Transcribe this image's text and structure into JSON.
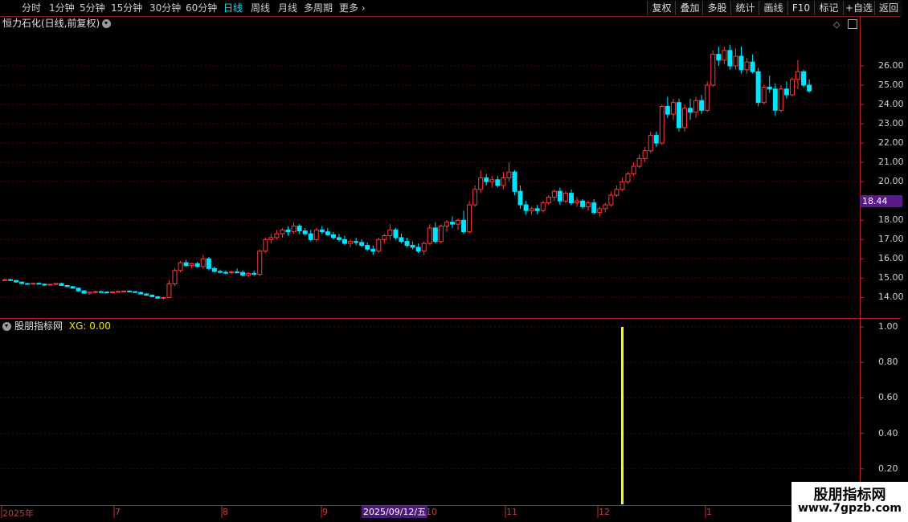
{
  "toolbar": {
    "periods": [
      "分时",
      "1分钟",
      "5分钟",
      "15分钟",
      "30分钟",
      "60分钟",
      "日线",
      "周线",
      "月线",
      "多周期",
      "更多"
    ],
    "active_period": "日线",
    "buttons": [
      "复权",
      "叠加",
      "多股",
      "统计",
      "画线",
      "F10",
      "标记",
      "+自选",
      "返回"
    ]
  },
  "main_chart": {
    "title": "恒力石化(日线,前复权)",
    "current_price": "18.44",
    "y_ticks": [
      "26.00",
      "25.00",
      "24.00",
      "23.00",
      "22.00",
      "21.00",
      "20.00",
      "18.00",
      "17.00",
      "16.00",
      "15.00",
      "14.00"
    ]
  },
  "indicator": {
    "name": "股朋指标网",
    "value_label": "XG: 0.00",
    "y_ticks": [
      "1.00",
      "0.80",
      "0.60",
      "0.40",
      "0.20"
    ]
  },
  "x_axis": {
    "labels": [
      "2025年",
      "7",
      "8",
      "9",
      "10",
      "11",
      "12",
      "1"
    ],
    "cursor_date": "2025/09/12/五"
  },
  "watermark": {
    "title": "股朋指标网",
    "url": "www.7gpzb.com"
  },
  "colors": {
    "up": "#ff3b3b",
    "down": "#00e5ff",
    "grid": "#5a0000",
    "signal": "#ffff00"
  },
  "chart_data": {
    "type": "candlestick",
    "title": "恒力石化(日线,前复权)",
    "ylim": [
      13.6,
      27.0
    ],
    "note_last_price": 18.44,
    "candles": [
      [
        14.9,
        14.95,
        14.85,
        14.92
      ],
      [
        14.92,
        14.98,
        14.86,
        14.88
      ],
      [
        14.88,
        14.9,
        14.78,
        14.8
      ],
      [
        14.8,
        14.82,
        14.7,
        14.72
      ],
      [
        14.72,
        14.76,
        14.66,
        14.7
      ],
      [
        14.7,
        14.75,
        14.66,
        14.73
      ],
      [
        14.73,
        14.78,
        14.68,
        14.69
      ],
      [
        14.69,
        14.72,
        14.6,
        14.64
      ],
      [
        14.64,
        14.7,
        14.62,
        14.68
      ],
      [
        14.68,
        14.74,
        14.66,
        14.72
      ],
      [
        14.72,
        14.76,
        14.6,
        14.62
      ],
      [
        14.62,
        14.66,
        14.54,
        14.56
      ],
      [
        14.56,
        14.6,
        14.46,
        14.48
      ],
      [
        14.48,
        14.52,
        14.3,
        14.34
      ],
      [
        14.34,
        14.38,
        14.2,
        14.22
      ],
      [
        14.22,
        14.3,
        14.14,
        14.28
      ],
      [
        14.28,
        14.34,
        14.24,
        14.3
      ],
      [
        14.3,
        14.36,
        14.26,
        14.28
      ],
      [
        14.28,
        14.32,
        14.22,
        14.26
      ],
      [
        14.26,
        14.3,
        14.2,
        14.29
      ],
      [
        14.29,
        14.35,
        14.25,
        14.31
      ],
      [
        14.31,
        14.36,
        14.26,
        14.33
      ],
      [
        14.33,
        14.38,
        14.28,
        14.3
      ],
      [
        14.3,
        14.34,
        14.24,
        14.26
      ],
      [
        14.26,
        14.3,
        14.16,
        14.18
      ],
      [
        14.18,
        14.22,
        14.08,
        14.12
      ],
      [
        14.12,
        14.16,
        14.0,
        14.04
      ],
      [
        14.04,
        14.08,
        13.92,
        13.96
      ],
      [
        13.96,
        14.02,
        13.88,
        14.0
      ],
      [
        14.0,
        14.9,
        13.98,
        14.7
      ],
      [
        14.7,
        15.5,
        14.6,
        15.4
      ],
      [
        15.4,
        15.9,
        15.3,
        15.8
      ],
      [
        15.8,
        15.95,
        15.6,
        15.65
      ],
      [
        15.65,
        15.8,
        15.5,
        15.75
      ],
      [
        15.75,
        15.85,
        15.55,
        15.6
      ],
      [
        15.6,
        16.2,
        15.5,
        16.0
      ],
      [
        16.0,
        16.1,
        15.4,
        15.5
      ],
      [
        15.5,
        15.6,
        15.3,
        15.35
      ],
      [
        15.35,
        15.45,
        15.25,
        15.3
      ],
      [
        15.3,
        15.4,
        15.2,
        15.28
      ],
      [
        15.28,
        15.38,
        15.2,
        15.32
      ],
      [
        15.32,
        15.5,
        15.25,
        15.3
      ],
      [
        15.3,
        15.4,
        15.1,
        15.15
      ],
      [
        15.15,
        15.3,
        15.05,
        15.25
      ],
      [
        15.25,
        15.4,
        15.15,
        15.2
      ],
      [
        15.2,
        16.5,
        15.1,
        16.4
      ],
      [
        16.4,
        17.1,
        16.3,
        17.0
      ],
      [
        17.0,
        17.3,
        16.8,
        17.1
      ],
      [
        17.1,
        17.5,
        17.0,
        17.3
      ],
      [
        17.3,
        17.6,
        17.1,
        17.5
      ],
      [
        17.5,
        17.7,
        17.2,
        17.4
      ],
      [
        17.4,
        17.9,
        17.3,
        17.7
      ],
      [
        17.7,
        17.8,
        17.3,
        17.45
      ],
      [
        17.45,
        17.6,
        17.2,
        17.3
      ],
      [
        17.3,
        17.5,
        16.9,
        17.0
      ],
      [
        17.0,
        17.6,
        16.9,
        17.5
      ],
      [
        17.5,
        17.7,
        17.3,
        17.4
      ],
      [
        17.4,
        17.6,
        17.2,
        17.25
      ],
      [
        17.25,
        17.4,
        17.0,
        17.1
      ],
      [
        17.1,
        17.3,
        16.9,
        17.0
      ],
      [
        17.0,
        17.2,
        16.7,
        16.8
      ],
      [
        16.8,
        17.0,
        16.6,
        16.9
      ],
      [
        16.9,
        17.1,
        16.7,
        16.85
      ],
      [
        16.85,
        17.0,
        16.6,
        16.7
      ],
      [
        16.7,
        16.85,
        16.4,
        16.5
      ],
      [
        16.5,
        16.7,
        16.2,
        16.4
      ],
      [
        16.4,
        17.1,
        16.3,
        17.0
      ],
      [
        17.0,
        17.3,
        16.8,
        17.2
      ],
      [
        17.2,
        17.8,
        17.0,
        17.5
      ],
      [
        17.5,
        17.6,
        17.0,
        17.1
      ],
      [
        17.1,
        17.3,
        16.8,
        16.9
      ],
      [
        16.9,
        17.1,
        16.6,
        16.7
      ],
      [
        16.7,
        16.9,
        16.5,
        16.6
      ],
      [
        16.6,
        16.8,
        16.3,
        16.4
      ],
      [
        16.4,
        16.9,
        16.2,
        16.8
      ],
      [
        16.8,
        17.8,
        16.7,
        17.6
      ],
      [
        17.6,
        17.9,
        16.8,
        16.9
      ],
      [
        16.9,
        17.8,
        16.8,
        17.7
      ],
      [
        17.7,
        18.0,
        17.4,
        17.9
      ],
      [
        17.9,
        18.2,
        17.6,
        17.8
      ],
      [
        17.8,
        18.1,
        17.5,
        18.0
      ],
      [
        18.0,
        18.5,
        17.3,
        17.4
      ],
      [
        17.4,
        19.0,
        17.3,
        18.8
      ],
      [
        18.8,
        19.8,
        18.7,
        19.6
      ],
      [
        19.6,
        20.6,
        19.4,
        20.2
      ],
      [
        20.2,
        20.4,
        19.8,
        20.0
      ],
      [
        20.0,
        20.3,
        19.7,
        20.1
      ],
      [
        20.1,
        20.3,
        19.7,
        19.8
      ],
      [
        19.8,
        20.5,
        19.6,
        20.2
      ],
      [
        20.2,
        21.0,
        20.0,
        20.5
      ],
      [
        20.5,
        20.6,
        19.3,
        19.5
      ],
      [
        19.5,
        19.8,
        18.6,
        18.8
      ],
      [
        18.8,
        19.0,
        18.3,
        18.5
      ],
      [
        18.5,
        18.7,
        18.3,
        18.6
      ],
      [
        18.6,
        18.8,
        18.3,
        18.5
      ],
      [
        18.5,
        19.0,
        18.4,
        18.9
      ],
      [
        18.9,
        19.3,
        18.8,
        19.2
      ],
      [
        19.2,
        19.6,
        19.0,
        19.5
      ],
      [
        19.5,
        19.7,
        18.8,
        19.0
      ],
      [
        19.0,
        19.5,
        18.9,
        19.4
      ],
      [
        19.4,
        19.6,
        18.8,
        18.9
      ],
      [
        18.9,
        19.2,
        18.7,
        19.0
      ],
      [
        19.0,
        19.1,
        18.6,
        18.7
      ],
      [
        18.7,
        19.0,
        18.5,
        18.9
      ],
      [
        18.9,
        19.1,
        18.3,
        18.4
      ],
      [
        18.4,
        18.7,
        18.2,
        18.6
      ],
      [
        18.6,
        18.9,
        18.4,
        18.8
      ],
      [
        18.8,
        19.5,
        18.7,
        19.3
      ],
      [
        19.3,
        19.8,
        19.2,
        19.6
      ],
      [
        19.6,
        20.2,
        19.5,
        20.0
      ],
      [
        20.0,
        20.5,
        19.9,
        20.4
      ],
      [
        20.4,
        21.0,
        20.3,
        20.8
      ],
      [
        20.8,
        21.4,
        20.7,
        21.2
      ],
      [
        21.2,
        21.8,
        21.0,
        21.6
      ],
      [
        21.6,
        22.6,
        21.5,
        22.4
      ],
      [
        22.4,
        22.6,
        21.8,
        22.0
      ],
      [
        22.0,
        24.0,
        21.9,
        23.9
      ],
      [
        23.9,
        24.4,
        23.3,
        23.5
      ],
      [
        23.5,
        24.3,
        23.2,
        24.1
      ],
      [
        24.1,
        24.3,
        22.6,
        22.8
      ],
      [
        22.8,
        24.0,
        22.6,
        23.8
      ],
      [
        23.8,
        24.3,
        23.2,
        23.6
      ],
      [
        23.6,
        24.4,
        23.3,
        24.2
      ],
      [
        24.2,
        24.5,
        23.5,
        23.7
      ],
      [
        23.7,
        25.2,
        23.6,
        25.0
      ],
      [
        25.0,
        26.8,
        24.9,
        26.6
      ],
      [
        26.6,
        27.0,
        26.0,
        26.3
      ],
      [
        26.3,
        27.0,
        26.1,
        26.8
      ],
      [
        26.8,
        27.1,
        25.8,
        26.0
      ],
      [
        26.0,
        26.9,
        25.8,
        26.5
      ],
      [
        26.5,
        27.0,
        25.6,
        25.8
      ],
      [
        25.8,
        26.4,
        25.6,
        26.2
      ],
      [
        26.2,
        26.6,
        25.6,
        25.7
      ],
      [
        25.7,
        25.9,
        23.9,
        24.1
      ],
      [
        24.1,
        25.0,
        24.0,
        24.9
      ],
      [
        24.9,
        25.5,
        24.6,
        24.8
      ],
      [
        24.8,
        25.1,
        23.4,
        23.7
      ],
      [
        23.7,
        25.0,
        23.6,
        24.8
      ],
      [
        24.8,
        25.2,
        24.3,
        24.5
      ],
      [
        24.5,
        25.4,
        24.4,
        25.3
      ],
      [
        25.3,
        26.3,
        24.8,
        25.7
      ],
      [
        25.7,
        25.8,
        24.9,
        25.0
      ],
      [
        25.0,
        25.3,
        24.6,
        24.7
      ]
    ],
    "indicator_series": {
      "name": "XG",
      "signal_index": 109,
      "signal_value": 1.0
    },
    "x_axis_labels": [
      "2025年",
      "7",
      "8",
      "9",
      "10",
      "11",
      "12",
      "1"
    ],
    "indicator_ylim": [
      0,
      1.05
    ],
    "grid": true
  }
}
